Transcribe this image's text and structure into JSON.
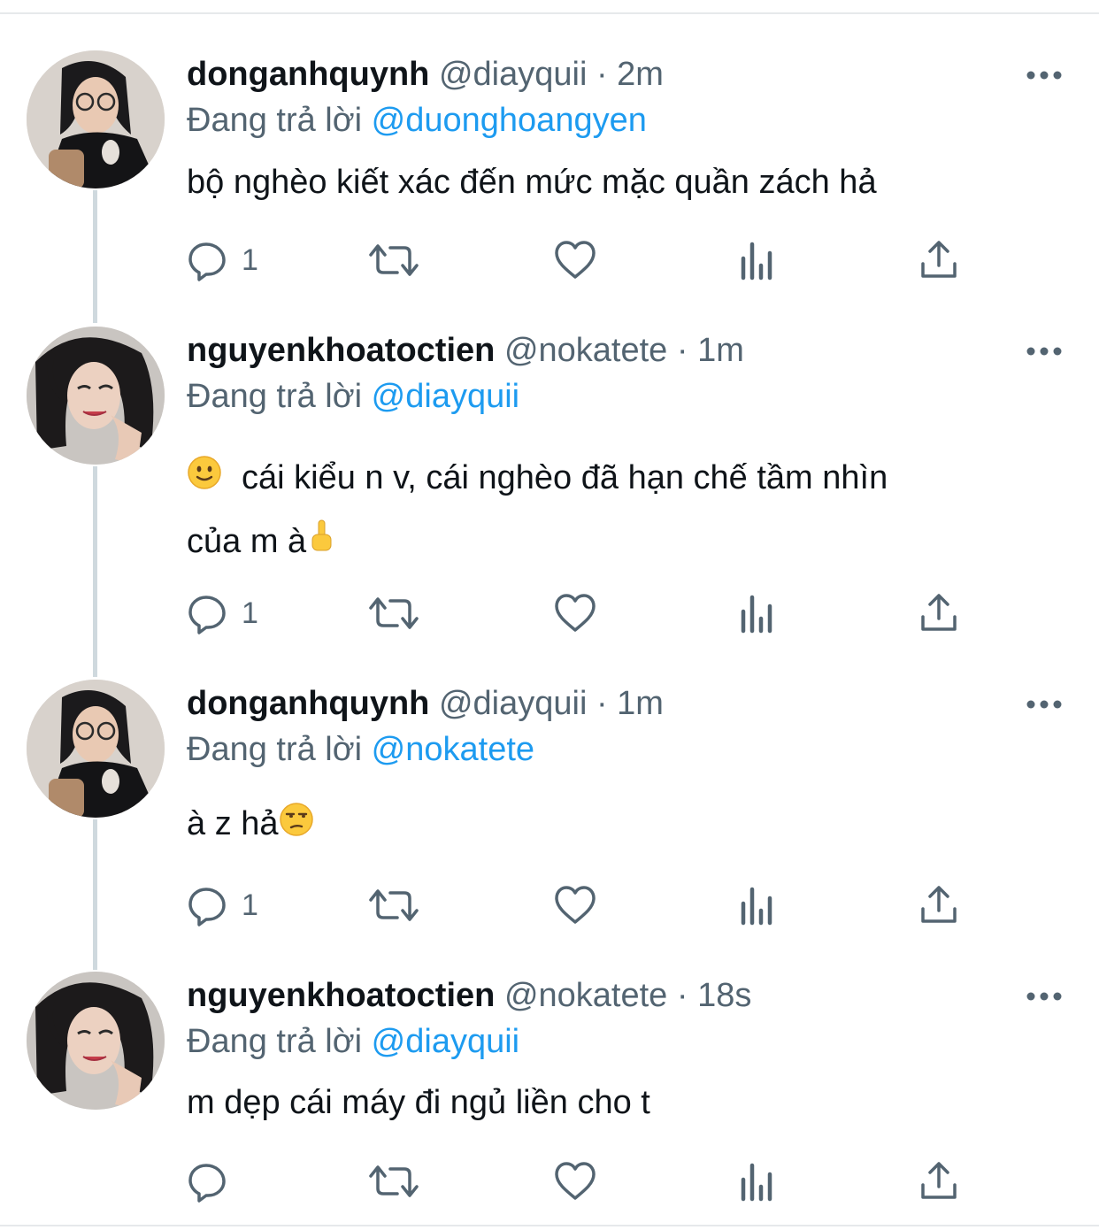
{
  "tweets": [
    {
      "name": "donganhquynh",
      "handle": "@diayquii",
      "dot": "·",
      "time": "2m",
      "reply_prefix": "Đang trả lời",
      "reply_to": "@duonghoangyen",
      "text": "bộ nghèo kiết xác đến mức mặc quần zách hả",
      "reply_count": "1",
      "avatar": "avatar-girl-glasses"
    },
    {
      "name": "nguyenkhoatoctien",
      "handle": "@nokatete",
      "dot": "·",
      "time": "1m",
      "reply_prefix": "Đang trả lời",
      "reply_to": "@diayquii",
      "text_line1": "cái kiểu n v, cái nghèo đã hạn chế tầm nhìn",
      "text_line2": "của m à",
      "emoji_lead": "slightly-smiling-face",
      "emoji_trail": "middle-finger",
      "reply_count": "1",
      "avatar": "avatar-girl-winking"
    },
    {
      "name": "donganhquynh",
      "handle": "@diayquii",
      "dot": "·",
      "time": "1m",
      "reply_prefix": "Đang trả lời",
      "reply_to": "@nokatete",
      "text": "à z hả",
      "emoji_trail": "unamused-face",
      "reply_count": "1",
      "avatar": "avatar-girl-glasses"
    },
    {
      "name": "nguyenkhoatoctien",
      "handle": "@nokatete",
      "dot": "·",
      "time": "18s",
      "reply_prefix": "Đang trả lời",
      "reply_to": "@diayquii",
      "text": "m dẹp cái máy đi ngủ liền cho t",
      "reply_count": "",
      "avatar": "avatar-girl-winking"
    }
  ],
  "icons": {
    "reply": "reply-bubble-icon",
    "retweet": "retweet-icon",
    "like": "heart-icon",
    "views": "bar-chart-icon",
    "share": "share-icon",
    "more": "more-dots-icon"
  },
  "colors": {
    "text": "#0f1419",
    "secondary": "#536471",
    "link": "#1d9bf0",
    "thread_line": "#cfd9de"
  }
}
